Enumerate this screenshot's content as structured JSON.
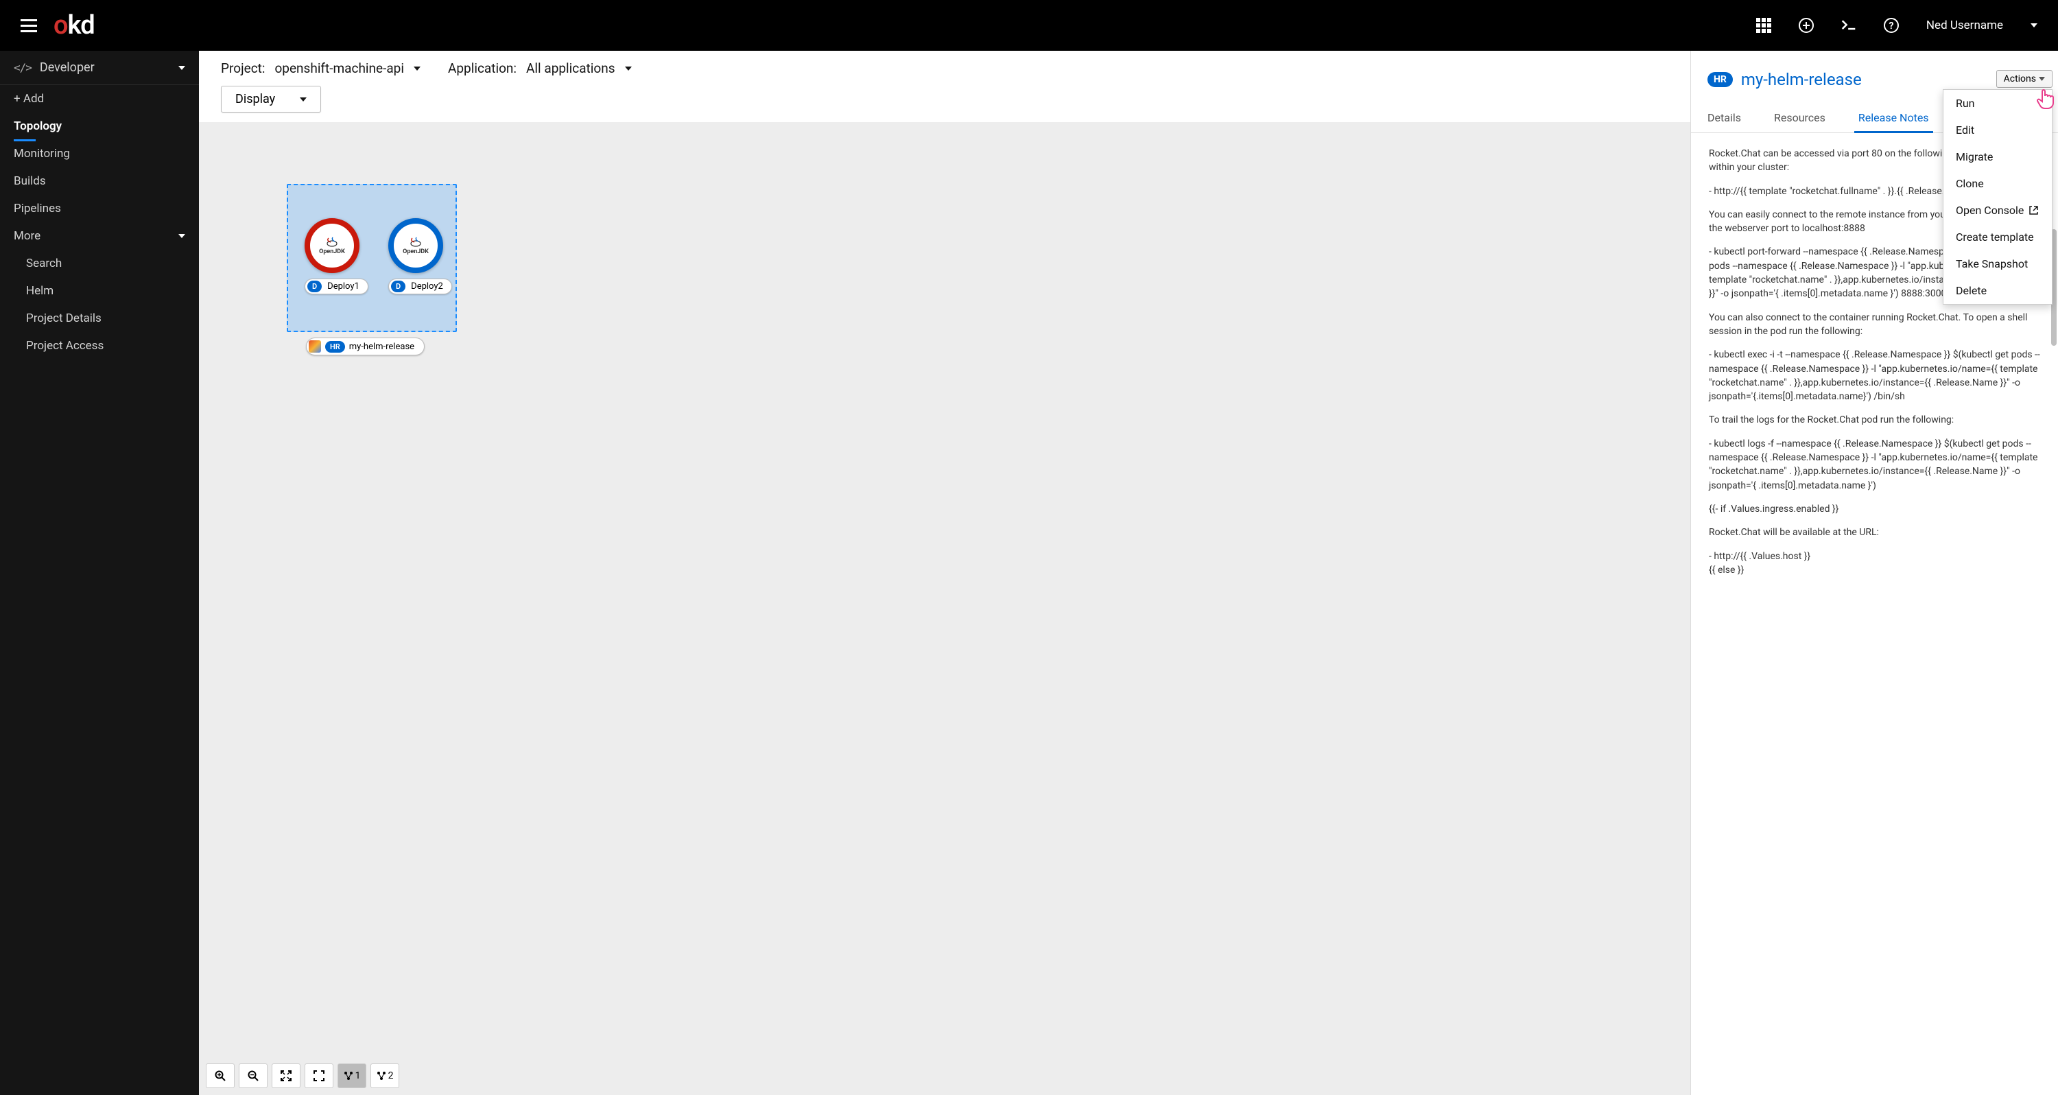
{
  "topbar": {
    "logo_o": "o",
    "logo_kd": "kd",
    "username": "Ned Username"
  },
  "perspective": {
    "label": "Developer"
  },
  "sidebar": {
    "items": [
      {
        "label": "+ Add"
      },
      {
        "label": "Topology",
        "active": true
      },
      {
        "label": "Monitoring"
      },
      {
        "label": "Builds"
      },
      {
        "label": "Pipelines"
      },
      {
        "label": "More",
        "expandable": true
      }
    ],
    "more": [
      {
        "label": "Search"
      },
      {
        "label": "Helm"
      },
      {
        "label": "Project Details"
      },
      {
        "label": "Project Access"
      }
    ]
  },
  "toolbar": {
    "project_label": "Project:",
    "project_value": "openshift-machine-api",
    "app_label": "Application:",
    "app_value": "All applications",
    "display": "Display"
  },
  "topology": {
    "nodes": [
      {
        "badge": "D",
        "label": "Deploy1",
        "runtime": "OpenJDK"
      },
      {
        "badge": "D",
        "label": "Deploy2",
        "runtime": "OpenJDK"
      }
    ],
    "appTag": {
      "badge": "HR",
      "label": "my-helm-release"
    }
  },
  "zoom": {
    "lay1": "1",
    "lay2": "2"
  },
  "panel": {
    "badge": "HR",
    "title": "my-helm-release",
    "actions_label": "Actions",
    "tabs": [
      {
        "label": "Details"
      },
      {
        "label": "Resources"
      },
      {
        "label": "Release Notes",
        "active": true
      }
    ],
    "actions_menu": [
      "Run",
      "Edit",
      "Migrate",
      "Clone",
      "Open Console",
      "Create template",
      "Take Snapshot",
      "Delete"
    ],
    "notes": [
      "Rocket.Chat can be accessed via port 80 on the following DNS name from within your cluster:",
      "- http://{{ template \"rocketchat.fullname\" . }}.{{ .Release.Namespace }}",
      "You can easily connect to the remote instance from your browser. Forward the webserver port to localhost:8888",
      "- kubectl port-forward --namespace {{ .Release.Namespace }} $(kubectl get pods --namespace {{ .Release.Namespace }} -l \"app.kubernetes.io/name={{ template \"rocketchat.name\" . }},app.kubernetes.io/instance={{ .Release.Name }}\" -o jsonpath='{ .items[0].metadata.name }') 8888:3000",
      "You can also connect to the container running Rocket.Chat. To open a shell session in the pod run the following:",
      "- kubectl exec -i -t --namespace {{ .Release.Namespace }} $(kubectl get pods --namespace {{ .Release.Namespace }} -l \"app.kubernetes.io/name={{ template \"rocketchat.name\" . }},app.kubernetes.io/instance={{ .Release.Name }}\" -o jsonpath='{.items[0].metadata.name}') /bin/sh",
      "To trail the logs for the Rocket.Chat pod run the following:",
      "- kubectl logs -f --namespace {{ .Release.Namespace }} $(kubectl get pods --namespace {{ .Release.Namespace }} -l \"app.kubernetes.io/name={{ template \"rocketchat.name\" . }},app.kubernetes.io/instance={{ .Release.Name }}\" -o jsonpath='{ .items[0].metadata.name }')",
      "{{- if .Values.ingress.enabled }}",
      "Rocket.Chat will be available at the URL:",
      "- http://{{ .Values.host }}\n{{ else }}"
    ]
  }
}
